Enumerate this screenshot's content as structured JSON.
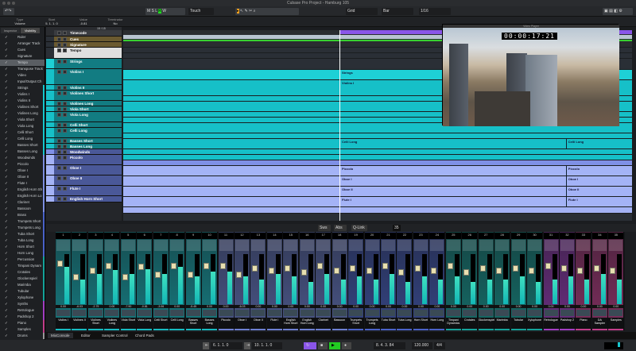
{
  "window": {
    "title": "Cubase Pro Project - Hamburg 105"
  },
  "toolbar": {
    "automation_mode": "Touch",
    "snap_type": "Grid",
    "grid_type": "Bar",
    "quantize": "1/16"
  },
  "infoline": [
    {
      "label": "Type",
      "value": "Volume"
    },
    {
      "label": "Start",
      "value": "5. 1. 1. 0"
    },
    {
      "label": "Value",
      "value": "-0.81"
    },
    {
      "label": "Terminator",
      "value": "No"
    }
  ],
  "leftpanel": {
    "tabs": [
      "Inspector",
      "Visibility"
    ],
    "bottom_tabs": [
      "Track",
      "Zones"
    ],
    "items": [
      {
        "label": "Ruler"
      },
      {
        "label": "Arranger Track"
      },
      {
        "label": "Cues"
      },
      {
        "label": "Signature"
      },
      {
        "label": "Tempo",
        "selected": true
      },
      {
        "label": "Transpose Track"
      },
      {
        "label": "Video"
      },
      {
        "label": "Input/Output Ch"
      },
      {
        "label": "Strings",
        "c": "#17c6cc"
      },
      {
        "label": "Violins I",
        "c": "#17c6cc"
      },
      {
        "label": "Violins II",
        "c": "#17c6cc"
      },
      {
        "label": "Violines Short",
        "c": "#17c6cc"
      },
      {
        "label": "Violines Long",
        "c": "#17c6cc"
      },
      {
        "label": "Viola Short",
        "c": "#17c6cc"
      },
      {
        "label": "Viola Long",
        "c": "#17c6cc"
      },
      {
        "label": "Celli Short",
        "c": "#17c6cc"
      },
      {
        "label": "Celli Long",
        "c": "#17c6cc"
      },
      {
        "label": "Basses Short",
        "c": "#17c6cc"
      },
      {
        "label": "Basses Long",
        "c": "#17c6cc"
      },
      {
        "label": "Woodwinds",
        "c": "#7d8fe0"
      },
      {
        "label": "Piccolo",
        "c": "#7d8fe0"
      },
      {
        "label": "Oboe I",
        "c": "#7d8fe0"
      },
      {
        "label": "Oboe II",
        "c": "#7d8fe0"
      },
      {
        "label": "Flute I",
        "c": "#7d8fe0"
      },
      {
        "label": "English Horn Sh",
        "c": "#7d8fe0"
      },
      {
        "label": "English Horn Lo",
        "c": "#7d8fe0"
      },
      {
        "label": "Clarinet",
        "c": "#7d8fe0"
      },
      {
        "label": "Bassoon",
        "c": "#7d8fe0"
      },
      {
        "label": "Brass",
        "c": "#4a62c8"
      },
      {
        "label": "Trumpets Short",
        "c": "#4a62c8"
      },
      {
        "label": "Trumpets Long",
        "c": "#4a62c8"
      },
      {
        "label": "Tuba Short",
        "c": "#4a62c8"
      },
      {
        "label": "Tuba Long",
        "c": "#4a62c8"
      },
      {
        "label": "Horn Short",
        "c": "#4a62c8"
      },
      {
        "label": "Horn Long",
        "c": "#4a62c8"
      },
      {
        "label": "Percussion",
        "c": "#15a39a"
      },
      {
        "label": "Timpani Dynam",
        "c": "#15a39a"
      },
      {
        "label": "Crotales",
        "c": "#15a39a"
      },
      {
        "label": "Glockenspiel",
        "c": "#15a39a"
      },
      {
        "label": "Marimba",
        "c": "#15a39a"
      },
      {
        "label": "Tubular",
        "c": "#15a39a"
      },
      {
        "label": "Xylophone",
        "c": "#15a39a"
      },
      {
        "label": "Synths",
        "c": "#a23ec2"
      },
      {
        "label": "Retrologue",
        "c": "#a23ec2"
      },
      {
        "label": "Padshop 2",
        "c": "#a23ec2"
      },
      {
        "label": "Piano",
        "c": "#c23e8a"
      },
      {
        "label": "Samples",
        "c": "#c23e8a"
      },
      {
        "label": "Drums",
        "c": "#999"
      }
    ]
  },
  "tracklist": {
    "count": "15 / 15",
    "tracks": [
      {
        "name": "Timecode",
        "h": 8,
        "bg": "#3a3c40",
        "lane": "#2a2c30"
      },
      {
        "name": "Cues",
        "h": 7,
        "bg": "#6b5a30",
        "lane": "#2a2f36"
      },
      {
        "name": "Signature",
        "h": 7,
        "bg": "#6b5a30",
        "lane": "#2a2f36"
      },
      {
        "name": "Tempo",
        "h": 14,
        "bg": "#e0e0e0",
        "fg": "#111",
        "lane": "#2a2f36"
      },
      {
        "name": "Strings",
        "h": 13,
        "bg": "#127c82",
        "lane": "#1ed0d6",
        "events": [
          {
            "at": 0.425,
            "label": "Strings"
          }
        ]
      },
      {
        "name": "Violins I",
        "h": 20,
        "bg": "#127c82",
        "lane": "#16c0c8",
        "events": [
          {
            "at": 0.425,
            "label": "Violins I"
          }
        ]
      },
      {
        "name": "Violins II",
        "h": 7,
        "bg": "#127c82",
        "lane": "#16c0c8"
      },
      {
        "name": "Violines Short",
        "h": 13,
        "bg": "#127c82",
        "lane": "#16c0c8"
      },
      {
        "name": "Violines Long",
        "h": 7,
        "bg": "#127c82",
        "lane": "#16c0c8"
      },
      {
        "name": "Viola Short",
        "h": 7,
        "bg": "#127c82",
        "lane": "#16c0c8"
      },
      {
        "name": "Viola Long",
        "h": 13,
        "bg": "#127c82",
        "lane": "#16c0c8"
      },
      {
        "name": "Celli Short",
        "h": 7,
        "bg": "#127c82",
        "lane": "#16c0c8"
      },
      {
        "name": "Celli Long",
        "h": 13,
        "bg": "#127c82",
        "lane": "#16c0c8",
        "events": [
          {
            "at": 0.425,
            "label": "Celli Long"
          },
          {
            "at": 0.87,
            "label": "Celli Long"
          }
        ]
      },
      {
        "name": "Basses Short",
        "h": 7,
        "bg": "#127c82",
        "lane": "#16c0c8"
      },
      {
        "name": "Basses Long",
        "h": 7,
        "bg": "#127c82",
        "lane": "#16c0c8"
      },
      {
        "name": "Woodwinds",
        "h": 7,
        "bg": "#4a5898",
        "lane": "#7f90e6"
      },
      {
        "name": "Piccolo",
        "h": 13,
        "bg": "#4a5898",
        "lane": "#a4b3f6",
        "events": [
          {
            "at": 0.425,
            "label": "Piccolo"
          },
          {
            "at": 0.87,
            "label": "Piccolo"
          }
        ]
      },
      {
        "name": "Oboe I",
        "h": 13,
        "bg": "#4a5898",
        "lane": "#a4b3f6",
        "events": [
          {
            "at": 0.425,
            "label": "Oboe I"
          },
          {
            "at": 0.87,
            "label": "Oboe I"
          }
        ]
      },
      {
        "name": "Oboe II",
        "h": 13,
        "bg": "#4a5898",
        "lane": "#a4b3f6",
        "events": [
          {
            "at": 0.425,
            "label": "Oboe II"
          },
          {
            "at": 0.87,
            "label": "Oboe II"
          }
        ]
      },
      {
        "name": "Flute I",
        "h": 13,
        "bg": "#4a5898",
        "lane": "#a4b3f6",
        "events": [
          {
            "at": 0.425,
            "label": "Flute I"
          },
          {
            "at": 0.87,
            "label": "Flute I"
          }
        ]
      },
      {
        "name": "English Horn Short",
        "h": 8,
        "bg": "#4a5898",
        "lane": "#a4b3f6"
      }
    ]
  },
  "video": {
    "title": "Video Player",
    "timecode": "00:00:17:21"
  },
  "mixtool": {
    "buttons": [
      "Sws",
      "Abs",
      "Q-Link"
    ],
    "count": "35"
  },
  "mixer": {
    "channels": [
      {
        "n": "1",
        "name": "Violins I",
        "v": "0.00",
        "f": 0.15,
        "m": 0.75,
        "c": "#17b9bf"
      },
      {
        "n": "2",
        "name": "Violines II",
        "v": "-6.03",
        "f": 0.45,
        "m": 0.5,
        "c": "#17b9bf"
      },
      {
        "n": "3",
        "name": "Violines Short",
        "v": "-2.79",
        "f": 0.3,
        "m": 0.6,
        "c": "#17b9bf"
      },
      {
        "n": "4",
        "name": "Violines Long",
        "v": "0.00",
        "f": 0.2,
        "m": 0.68,
        "c": "#17b9bf"
      },
      {
        "n": "5",
        "name": "Viola Short",
        "v": "-7.90",
        "f": 0.45,
        "m": 0.6,
        "c": "#17b9bf"
      },
      {
        "n": "6",
        "name": "Viola Long",
        "v": "-0.81",
        "f": 0.22,
        "m": 0.7,
        "c": "#17b9bf"
      },
      {
        "n": "7",
        "name": "Celli Short",
        "v": "-3.06",
        "f": 0.4,
        "m": 0.6,
        "c": "#17b9bf"
      },
      {
        "n": "8",
        "name": "Celli Long",
        "v": "0.00",
        "f": 0.2,
        "m": 0.74,
        "c": "#17b9bf"
      },
      {
        "n": "9",
        "name": "Basses Short",
        "v": "-5.45",
        "f": 0.4,
        "m": 0.55,
        "c": "#17b9bf"
      },
      {
        "n": "10",
        "name": "Basses Long",
        "v": "0.00",
        "f": 0.2,
        "m": 0.65,
        "c": "#17b9bf"
      },
      {
        "n": "11",
        "name": "Piccolo",
        "v": "0.00",
        "f": 0.2,
        "m": 0.65,
        "c": "#6d7fd0"
      },
      {
        "n": "12",
        "name": "Oboe I",
        "v": "-6.03",
        "f": 0.4,
        "m": 0.55,
        "c": "#6d7fd0"
      },
      {
        "n": "13",
        "name": "Oboe II",
        "v": "0.00",
        "f": 0.25,
        "m": 0.5,
        "c": "#6d7fd0"
      },
      {
        "n": "14",
        "name": "Flute I",
        "v": "0.00",
        "f": 0.3,
        "m": 0.6,
        "c": "#6d7fd0"
      },
      {
        "n": "15",
        "name": "English Horn Short",
        "v": "0.00",
        "f": 0.25,
        "m": 0.55,
        "c": "#6d7fd0"
      },
      {
        "n": "16",
        "name": "English Horn Long",
        "v": "0.00",
        "f": 0.35,
        "m": 0.45,
        "c": "#6d7fd0"
      },
      {
        "n": "17",
        "name": "Clarinet",
        "v": "0.00",
        "f": 0.2,
        "m": 0.6,
        "c": "#6d7fd0"
      },
      {
        "n": "18",
        "name": "Bassoon",
        "v": "0.00",
        "f": 0.3,
        "m": 0.5,
        "c": "#6d7fd0"
      },
      {
        "n": "19",
        "name": "Trumpets Short",
        "v": "0.00",
        "f": 0.25,
        "m": 0.55,
        "c": "#4a62c8"
      },
      {
        "n": "20",
        "name": "Trumpets Long",
        "v": "0.00",
        "f": 0.3,
        "m": 0.5,
        "c": "#4a62c8"
      },
      {
        "n": "21",
        "name": "Tuba Short",
        "v": "0.00",
        "f": 0.2,
        "m": 0.6,
        "c": "#4a62c8"
      },
      {
        "n": "22",
        "name": "Tuba Long",
        "v": "0.00",
        "f": 0.35,
        "m": 0.45,
        "c": "#4a62c8"
      },
      {
        "n": "23",
        "name": "Horn Short",
        "v": "0.00",
        "f": 0.25,
        "m": 0.55,
        "c": "#4a62c8"
      },
      {
        "n": "24",
        "name": "Horn Long",
        "v": "0.00",
        "f": 0.3,
        "m": 0.5,
        "c": "#4a62c8"
      },
      {
        "n": "25",
        "name": "Timpani Dynamics",
        "v": "0.00",
        "f": 0.2,
        "m": 0.55,
        "c": "#15a39a"
      },
      {
        "n": "26",
        "name": "Crotales",
        "v": "0.00",
        "f": 0.35,
        "m": 0.45,
        "c": "#15a39a"
      },
      {
        "n": "27",
        "name": "Glockenspiel",
        "v": "0.00",
        "f": 0.25,
        "m": 0.5,
        "c": "#15a39a"
      },
      {
        "n": "28",
        "name": "Marimba",
        "v": "0.00",
        "f": 0.3,
        "m": 0.5,
        "c": "#15a39a"
      },
      {
        "n": "29",
        "name": "Tubular",
        "v": "0.00",
        "f": 0.25,
        "m": 0.55,
        "c": "#15a39a"
      },
      {
        "n": "30",
        "name": "Xylophone",
        "v": "0.00",
        "f": 0.3,
        "m": 0.45,
        "c": "#15a39a"
      },
      {
        "n": "31",
        "name": "Retrologue",
        "v": "0.00",
        "f": 0.2,
        "m": 0.5,
        "c": "#a23ec2"
      },
      {
        "n": "32",
        "name": "Padshop 2",
        "v": "0.00",
        "f": 0.25,
        "m": 0.55,
        "c": "#a23ec2"
      },
      {
        "n": "33",
        "name": "Piano",
        "v": "0.00",
        "f": 0.3,
        "m": 0.5,
        "c": "#c23e8a"
      },
      {
        "n": "34",
        "name": "DA Sampler",
        "v": "0.00",
        "f": 0.25,
        "m": 0.6,
        "c": "#c23e8a"
      },
      {
        "n": "35",
        "name": "Samples",
        "v": "0.00",
        "f": 0.3,
        "m": 0.5,
        "c": "#c23e8a"
      }
    ]
  },
  "bottomtabs": [
    "MixConsole",
    "Editor",
    "Sampler Control",
    "Chord Pads"
  ],
  "transport": {
    "left_locator": "6. 1. 1. 0",
    "right_locator": "10. 1. 1. 0",
    "position": "8. 4. 3. 84",
    "tempo": "120.000",
    "signature": "4/4"
  }
}
